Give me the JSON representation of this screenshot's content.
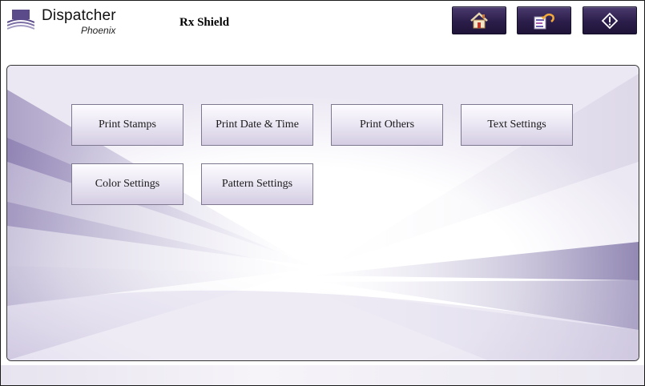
{
  "header": {
    "logo": {
      "title": "Dispatcher",
      "subtitle": "Phoenix"
    },
    "app_title": "Rx Shield",
    "buttons": [
      {
        "name": "home",
        "icon": "home-icon"
      },
      {
        "name": "back",
        "icon": "back-icon"
      },
      {
        "name": "info",
        "icon": "info-icon"
      }
    ]
  },
  "menu": {
    "items": [
      {
        "label": "Print Stamps"
      },
      {
        "label": "Print Date & Time"
      },
      {
        "label": "Print Others"
      },
      {
        "label": "Text Settings"
      },
      {
        "label": "Color Settings"
      },
      {
        "label": "Pattern Settings"
      }
    ]
  },
  "colors": {
    "header_button": "#2b1d4a",
    "accent_purple": "#6a5a9a",
    "button_face": "#ece8f4"
  }
}
